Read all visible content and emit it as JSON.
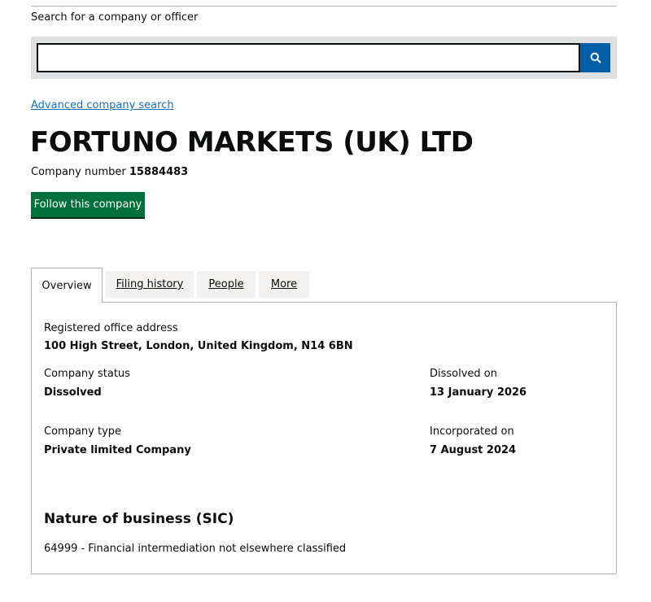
{
  "search": {
    "label": "Search for a company or officer",
    "value": "",
    "placeholder": "",
    "button_icon": "search-icon"
  },
  "advanced_search_link": "Advanced company search",
  "company": {
    "name": "FORTUNO MARKETS (UK) LTD",
    "number_label": "Company number",
    "number": "15884483",
    "follow_label": "Follow this company"
  },
  "tabs": [
    {
      "label": "Overview",
      "active": true
    },
    {
      "label": "Filing history",
      "active": false
    },
    {
      "label": "People",
      "active": false
    },
    {
      "label": "More",
      "active": false
    }
  ],
  "overview": {
    "address_label": "Registered office address",
    "address": "100 High Street, London, United Kingdom, N14 6BN",
    "status_label": "Company status",
    "status": "Dissolved",
    "dissolved_label": "Dissolved on",
    "dissolved": "13 January 2026",
    "type_label": "Company type",
    "type": "Private limited Company",
    "incorporated_label": "Incorporated on",
    "incorporated": "7 August 2024",
    "sic_heading": "Nature of business (SIC)",
    "sic": "64999 - Financial intermediation not elsewhere classified"
  },
  "colors": {
    "link": "#1d70b8",
    "search_button": "#005ea5",
    "follow_button": "#00703c",
    "search_panel": "#dee0e2",
    "tab_inactive": "#f3f2f1"
  }
}
